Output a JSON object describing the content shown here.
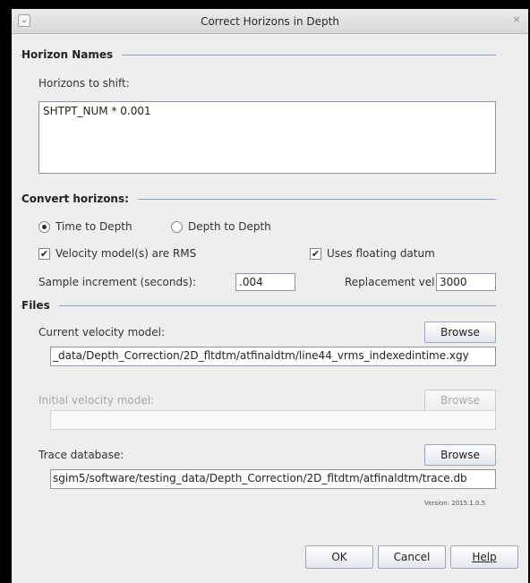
{
  "window": {
    "title": "Correct Horizons in Depth",
    "menu_glyph": "⌄",
    "close_glyph": "×"
  },
  "horizon_names": {
    "section_title": "Horizon Names",
    "shift_label": "Horizons to shift:",
    "shift_value": "SHTPT_NUM * 0.001"
  },
  "convert": {
    "section_title": "Convert horizons:",
    "radio_time_label": "Time to Depth",
    "radio_depth_label": "Depth to Depth",
    "selected": "time",
    "vel_rms_label": "Velocity model(s) are RMS",
    "vel_rms_checked": true,
    "floating_label": "Uses floating datum",
    "floating_checked": true,
    "sample_label": "Sample increment (seconds):",
    "sample_value": ".004",
    "replacement_label": "Replacement vel:",
    "replacement_value": "3000"
  },
  "files": {
    "section_title": "Files",
    "current_label": "Current velocity model:",
    "current_value": "_data/Depth_Correction/2D_fltdtm/atfinaldtm/line44_vrms_indexedintime.xgy",
    "initial_label": "Initial velocity model:",
    "initial_value": "",
    "trace_label": "Trace database:",
    "trace_value": "sgim5/software/testing_data/Depth_Correction/2D_fltdtm/atfinaldtm/trace.db",
    "browse_label": "Browse"
  },
  "version": "Version: 2015.1.0.5",
  "buttons": {
    "ok": "OK",
    "cancel": "Cancel",
    "help": "Help"
  }
}
